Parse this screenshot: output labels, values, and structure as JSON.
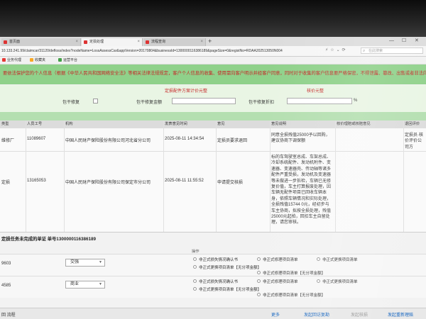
{
  "tabs": [
    {
      "label": "首页面"
    },
    {
      "label": "定损处理"
    },
    {
      "label": "流程查询"
    }
  ],
  "window": {
    "minimize": "—",
    "maximize": "☐",
    "close": "✕"
  },
  "address": {
    "url": "10.133.241.99/claimcar/31120/defloss/index?nodeName=LossAssessCar&appVersion=20170804&businessId=1300000116386189&pageSize=0&registNo=RDAA202513050N004",
    "search_placeholder": "在此搜索"
  },
  "bookmarks": [
    {
      "label": "业务代理",
      "color": "#e53935"
    },
    {
      "label": "收藏夹",
      "color": "#f9a825"
    },
    {
      "label": "运营平台",
      "color": "#43a047"
    }
  ],
  "notice": {
    "text": "要依法保护您的个人信息（根据《中华人民共和国网络安全法》等相关法律法规规定，客户个人信息的收集、使用需向客户明示并经客户同意，同时对于收集的客户信息要严格保密，不得泄露、篡改、出售或者非法向他人提供）"
  },
  "summary": {
    "left_header": "定损配件方案计价元整",
    "right_header": "核价元整",
    "fields": [
      {
        "label": "包干修复"
      },
      {
        "label": "包干修复金额"
      },
      {
        "label": "包干修复折扣"
      }
    ],
    "percent_unit": "%"
  },
  "table": {
    "headers": [
      "类型",
      "人员工号",
      "机构",
      "发表意见时间",
      "意见",
      "意见说明",
      "核价理赔或核赔意见",
      "退回评价"
    ],
    "rows": [
      {
        "type": "维修厂",
        "staff_id": "11089607",
        "org": "中国人民财产保险股份有限公司河北省分公司",
        "time": "2025-08-11 14:34:54",
        "opinion": "定损员要求退回",
        "desc": "同意全损残值25000予以回购，建议协商下调保额",
        "review": "",
        "feedback": "定损员·核价评价公司方"
      },
      {
        "type": "定损",
        "staff_id": "13165053",
        "org": "中国人民财产保险股份有限公司保定市分公司",
        "time": "2025-08-11 11:55:52",
        "opinion": "申请提交核损",
        "desc": "标的车驾驶室总成、车架总成、冷却系统配件、发动机附件、变速器、变速器壳、传动轴等诸多配件严重受损，发动机及变速器等未做进一步拆检，车辆已无修复价值，车主打算报废处理，因车辆无配件项目已回收车辆本身，依照车辆情况和实际处理，全损残值15744 0元，经初步与车主协商，拟按全损处理，残值25000元起拍，回扣车主自留处理，请您审核。",
        "review": "",
        "feedback": ""
      }
    ]
  },
  "task": {
    "title": "定损任务未完成的单证 单号1300000116386189",
    "ops_label": "操作",
    "rows": [
      {
        "id": "9603",
        "select_value": "交强",
        "options": [
          "非正式损失情况确认书",
          "非正式修理项目清单",
          "非正式更换项目清单",
          "非正式更换项目清单【无分项金额】",
          "非正式修理项目清单【无分项金额】"
        ]
      },
      {
        "id": "4585",
        "select_value": "商业",
        "options": [
          "非正式损失情况确认书",
          "非正式修理项目清单",
          "非正式更换项目清单",
          "非正式更换项目清单【无分项金额】",
          "非正式修理项目清单【无分项金额】"
        ]
      }
    ]
  },
  "footer": {
    "left": "回 流程",
    "more": "更多",
    "actions": [
      "发起回访复勘",
      "发起核损",
      "发起重新理赔"
    ]
  }
}
